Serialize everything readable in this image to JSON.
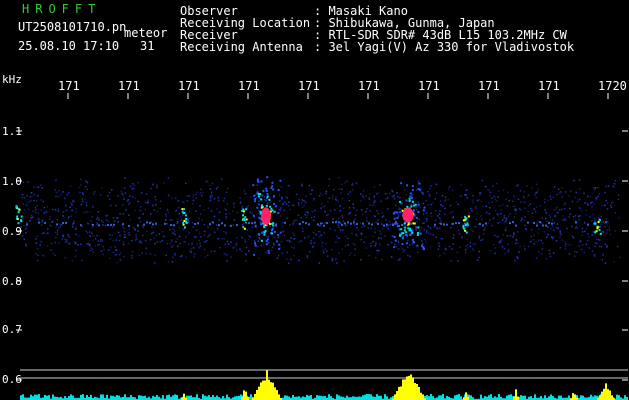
{
  "header": {
    "system_name": "HROFFT",
    "file_name": "UT2508101710.pn",
    "mode_label": "meteor",
    "date_time": "25.08.10 17:10",
    "count": "31",
    "info_labels": [
      "Observer",
      "Receiving Location",
      "Receiver",
      "Receiving Antenna"
    ],
    "info_values": [
      ": Masaki Kano",
      ": Shibukawa, Gunma, Japan",
      ": RTL-SDR SDR# 43dB L15 103.2MHz CW",
      ": 3el Yagi(V) Az 330 for Vladivostok"
    ]
  },
  "axes": {
    "y_unit": "kHz",
    "y_ticks": [
      "1.1",
      "1.0",
      "0.9",
      "0.8",
      "0.7",
      "0.6"
    ],
    "x_ticks": [
      "171",
      "171",
      "171",
      "171",
      "171",
      "171",
      "171",
      "171",
      "171",
      "1720"
    ]
  },
  "colors": {
    "background": "#000000",
    "noise_blue": "#1a2a9a",
    "signal_cyan": "#00e0e0",
    "signal_yellow": "#ffff00",
    "signal_red": "#ff2266",
    "text_green": "#33cc33",
    "grid": "#ffffff"
  }
}
